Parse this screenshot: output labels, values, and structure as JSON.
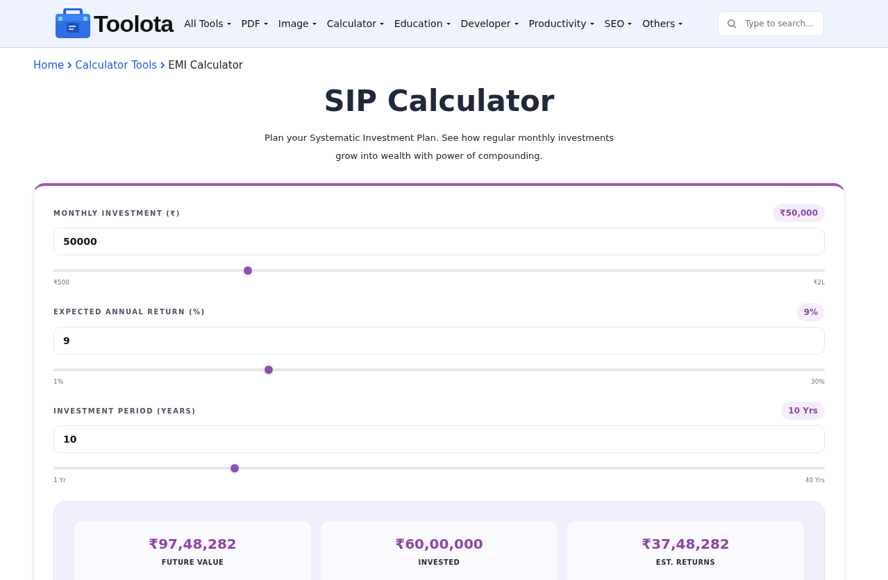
{
  "header": {
    "logo": "Toolota",
    "nav": [
      {
        "label": "All Tools"
      },
      {
        "label": "PDF"
      },
      {
        "label": "Image"
      },
      {
        "label": "Calculator"
      },
      {
        "label": "Education"
      },
      {
        "label": "Developer"
      },
      {
        "label": "Productivity"
      },
      {
        "label": "SEO"
      },
      {
        "label": "Others"
      }
    ],
    "search": {
      "placeholder": "Type to search..."
    }
  },
  "breadcrumb": {
    "links": [
      "Home",
      "Calculator Tools"
    ],
    "current": "EMI Calculator"
  },
  "title": "SIP Calculator",
  "subtitle": [
    "Plan your Systematic Investment Plan. See how regular monthly investments",
    "grow into wealth with power of compounding."
  ],
  "inputs": [
    {
      "label": "MONTHLY INVESTMENT (₹)",
      "badge": "₹50,000",
      "value": "50000",
      "level": 0.252,
      "min": "₹500",
      "max": "₹2L"
    },
    {
      "label": "EXPECTED ANNUAL RETURN (%)",
      "badge": "9%",
      "value": "9",
      "level": 0.279,
      "min": "1%",
      "max": "30%"
    },
    {
      "label": "INVESTMENT PERIOD (YEARS)",
      "badge": "10 Yrs",
      "value": "10",
      "level": 0.235,
      "min": "1 Yr",
      "max": "40 Yrs"
    }
  ],
  "results": [
    {
      "value": "₹97,48,282",
      "label": "FUTURE VALUE"
    },
    {
      "value": "₹60,00,000",
      "label": "INVESTED"
    },
    {
      "value": "₹37,48,282",
      "label": "EST. RETURNS"
    }
  ]
}
